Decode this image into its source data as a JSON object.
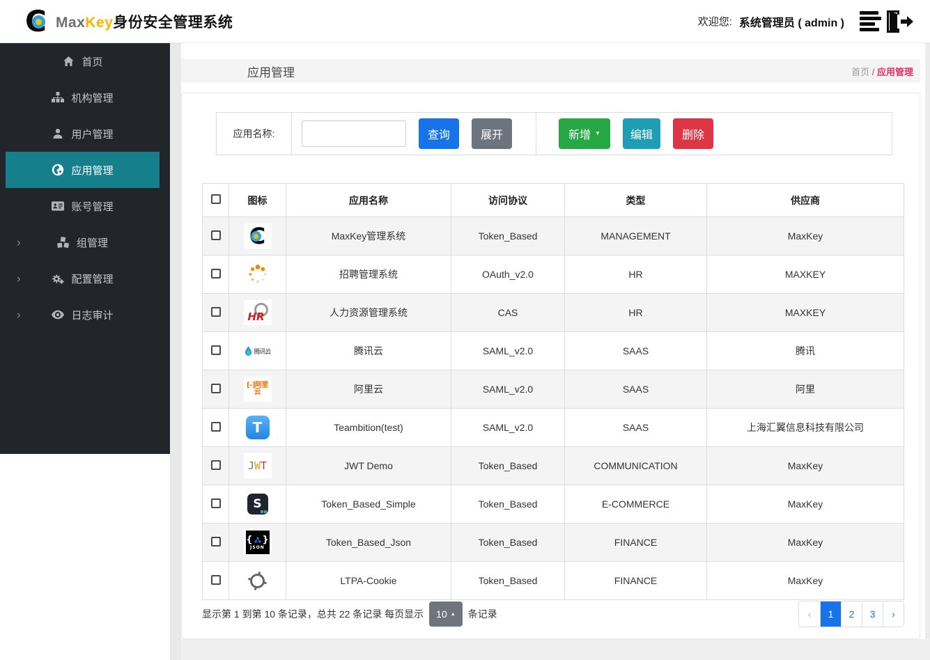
{
  "header": {
    "brand_max": "Max",
    "brand_key": "Key",
    "brand_suffix": "身份安全管理系统",
    "welcome_label": "欢迎您:",
    "user_name": "系统管理员 ( admin )",
    "icons": [
      "maxkey-logo",
      "list-icon",
      "logout-icon"
    ]
  },
  "sidebar": {
    "items": [
      {
        "key": "home",
        "label": "首页",
        "icon": "home-icon",
        "active": false,
        "expandable": false
      },
      {
        "key": "org",
        "label": "机构管理",
        "icon": "sitemap-icon",
        "active": false,
        "expandable": false
      },
      {
        "key": "user",
        "label": "用户管理",
        "icon": "user-icon",
        "active": false,
        "expandable": false
      },
      {
        "key": "app",
        "label": "应用管理",
        "icon": "globe-icon",
        "active": true,
        "expandable": false
      },
      {
        "key": "account",
        "label": "账号管理",
        "icon": "id-card-icon",
        "active": false,
        "expandable": false
      },
      {
        "key": "group",
        "label": "组管理",
        "icon": "cubes-icon",
        "active": false,
        "expandable": true
      },
      {
        "key": "config",
        "label": "配置管理",
        "icon": "gears-icon",
        "active": false,
        "expandable": true
      },
      {
        "key": "audit",
        "label": "日志审计",
        "icon": "eye-icon",
        "active": false,
        "expandable": true
      }
    ]
  },
  "page": {
    "title": "应用管理",
    "breadcrumb": {
      "home": "首页",
      "separator": " / ",
      "current": "应用管理"
    }
  },
  "toolbar": {
    "search_label": "应用名称:",
    "search_value": "",
    "query_label": "查询",
    "expand_label": "展开",
    "add_label": "新增",
    "edit_label": "编辑",
    "delete_label": "删除"
  },
  "table": {
    "columns": [
      {
        "key": "icon",
        "label": "图标"
      },
      {
        "key": "name",
        "label": "应用名称"
      },
      {
        "key": "protocol",
        "label": "访问协议"
      },
      {
        "key": "type",
        "label": "类型"
      },
      {
        "key": "vendor",
        "label": "供应商"
      }
    ],
    "rows": [
      {
        "icon": "maxkey",
        "name": "MaxKey管理系统",
        "protocol": "Token_Based",
        "type": "MANAGEMENT",
        "vendor": "MaxKey"
      },
      {
        "icon": "spinner-dots",
        "name": "招聘管理系统",
        "protocol": "OAuth_v2.0",
        "type": "HR",
        "vendor": "MAXKEY"
      },
      {
        "icon": "hr",
        "name": "人力资源管理系统",
        "protocol": "CAS",
        "type": "HR",
        "vendor": "MAXKEY"
      },
      {
        "icon": "tencent-cloud",
        "name": "腾讯云",
        "protocol": "SAML_v2.0",
        "type": "SAAS",
        "vendor": "腾讯"
      },
      {
        "icon": "aliyun",
        "name": "阿里云",
        "protocol": "SAML_v2.0",
        "type": "SAAS",
        "vendor": "阿里"
      },
      {
        "icon": "teambition",
        "name": "Teambition(test)",
        "protocol": "SAML_v2.0",
        "type": "SAAS",
        "vendor": "上海汇翼信息科技有限公司"
      },
      {
        "icon": "jwt",
        "name": "JWT Demo",
        "protocol": "Token_Based",
        "type": "COMMUNICATION",
        "vendor": "MaxKey"
      },
      {
        "icon": "s-dark",
        "name": "Token_Based_Simple",
        "protocol": "Token_Based",
        "type": "E-COMMERCE",
        "vendor": "MaxKey"
      },
      {
        "icon": "json",
        "name": "Token_Based_Json",
        "protocol": "Token_Based",
        "type": "FINANCE",
        "vendor": "MaxKey"
      },
      {
        "icon": "ltpa-crosshair",
        "name": "LTPA-Cookie",
        "protocol": "Token_Based",
        "type": "FINANCE",
        "vendor": "MaxKey"
      }
    ]
  },
  "pagination": {
    "summary_prefix": "显示第 1 到第 10 条记录，总共 22 条记录 每页显示",
    "page_size": "10",
    "summary_suffix": "条记录",
    "prev_glyph": "‹",
    "next_glyph": "›",
    "pages": [
      "1",
      "2",
      "3"
    ],
    "active_page": "1"
  },
  "colors": {
    "sidebar_bg": "#22262a",
    "sidebar_active": "#15808c",
    "primary_blue": "#1774e8",
    "secondary_gray": "#6c757d",
    "success_green": "#28a745",
    "info_teal": "#1f9db4",
    "danger_red": "#dc3545",
    "breadcrumb_pink": "#e5326b",
    "brand_yellow": "#f7b500",
    "stripe_gray": "#f4f4f4"
  }
}
